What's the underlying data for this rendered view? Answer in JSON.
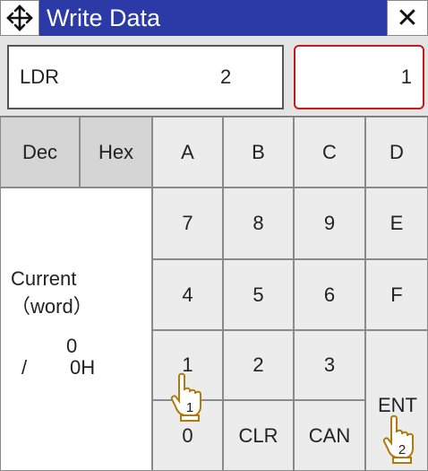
{
  "window": {
    "title": "Write Data",
    "move_icon": "move-arrows-icon",
    "close_icon": "close-icon",
    "close_glyph": "✕"
  },
  "device": {
    "name": "LDR",
    "number": "2"
  },
  "value_field": {
    "value": "1",
    "border_color": "#c51a1a"
  },
  "modes": [
    "Dec",
    "Hex"
  ],
  "keys": {
    "A": "A",
    "B": "B",
    "C": "C",
    "D": "D",
    "k7": "7",
    "k8": "8",
    "k9": "9",
    "E": "E",
    "k4": "4",
    "k5": "5",
    "k6": "6",
    "F": "F",
    "k1": "1",
    "k2": "2",
    "k3": "3",
    "k0": "0",
    "clr": "CLR",
    "can": "CAN",
    "ent": "ENT"
  },
  "current": {
    "label": "Current",
    "unit": "（word）",
    "value": "0",
    "separator": "/",
    "hex": "0H"
  },
  "callouts": [
    {
      "icon": "pointing-hand-icon",
      "step": "1"
    },
    {
      "icon": "pointing-hand-icon",
      "step": "2"
    }
  ],
  "colors": {
    "title_bar": "#2b3aa6",
    "accent_red": "#c51a1a"
  }
}
